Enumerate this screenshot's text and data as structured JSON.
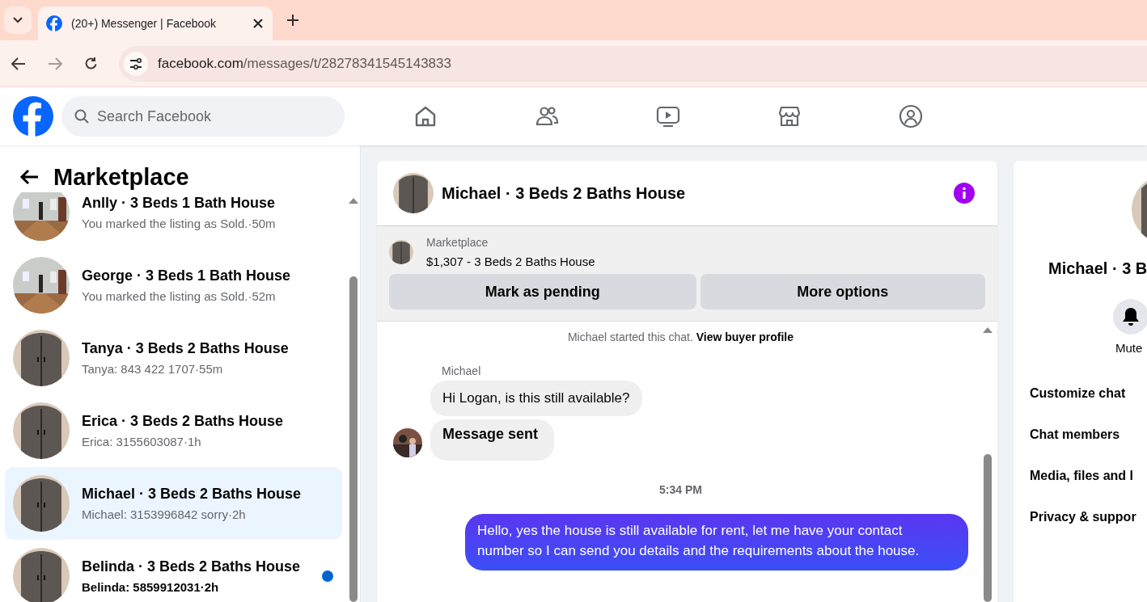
{
  "browser": {
    "tab_title": "(20+) Messenger | Facebook",
    "url_domain": "facebook.com",
    "url_path": "/messages/t/28278341545143833"
  },
  "topbar": {
    "search_placeholder": "Search Facebook"
  },
  "sidebar": {
    "title": "Marketplace",
    "conversations": [
      {
        "title": "Anlly · 3 Beds 1 Bath House",
        "preview": "You marked the listing as Sold.·50m",
        "selected": false,
        "unread": false
      },
      {
        "title": "George · 3 Beds 1 Bath House",
        "preview": "You marked the listing as Sold.·52m",
        "selected": false,
        "unread": false
      },
      {
        "title": "Tanya · 3 Beds 2 Baths House",
        "preview": "Tanya: 843 422 1707·55m",
        "selected": false,
        "unread": false
      },
      {
        "title": "Erica · 3 Beds 2 Baths House",
        "preview": "Erica: 3155603087·1h",
        "selected": false,
        "unread": false
      },
      {
        "title": "Michael · 3 Beds 2 Baths House",
        "preview": "Michael: 3153996842 sorry·2h",
        "selected": true,
        "unread": false
      },
      {
        "title": "Belinda · 3 Beds 2 Baths House",
        "preview": "Belinda: 5859912031·2h",
        "selected": false,
        "unread": true
      }
    ]
  },
  "chat": {
    "title": "Michael · 3 Beds 2 Baths House",
    "listing": {
      "label": "Marketplace",
      "summary": "$1,307 - 3 Beds 2 Baths House",
      "buttons": [
        "Mark as pending",
        "More options"
      ]
    },
    "messages": [
      {
        "kind": "system",
        "text": "Michael started this chat.",
        "link": "View buyer profile"
      },
      {
        "kind": "sender",
        "text": "Michael"
      },
      {
        "kind": "incoming",
        "text": "Hi Logan, is this still available?",
        "bold": false,
        "avatar": false
      },
      {
        "kind": "incoming",
        "text": "Message sent",
        "bold": true,
        "avatar": true
      },
      {
        "kind": "time",
        "text": "5:34 PM"
      },
      {
        "kind": "outgoing",
        "text": "Hello, yes the house is still available for rent, let me have your contact number so I can send you details and the requirements about the house."
      }
    ]
  },
  "details": {
    "title": "Michael · 3 B",
    "mute_label": "Mute",
    "menu": [
      "Customize chat",
      "Chat members",
      "Media, files and l",
      "Privacy & suppor"
    ]
  }
}
